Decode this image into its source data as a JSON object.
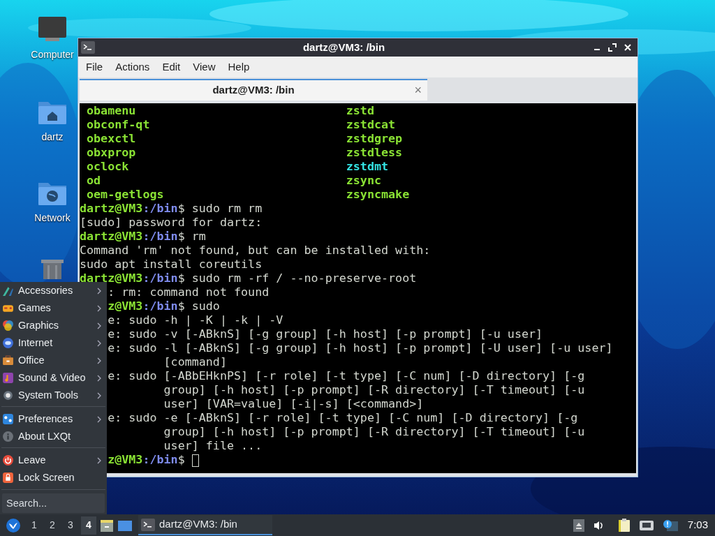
{
  "desktop_icons": [
    {
      "kind": "computer",
      "label": "Computer"
    },
    {
      "kind": "home",
      "label": "dartz"
    },
    {
      "kind": "network",
      "label": "Network"
    },
    {
      "kind": "trash"
    }
  ],
  "window": {
    "title": "dartz@VM3: /bin",
    "menu": [
      "File",
      "Actions",
      "Edit",
      "View",
      "Help"
    ],
    "tabs": [
      {
        "label": "dartz@VM3: /bin",
        "selected": true,
        "close": "×"
      }
    ]
  },
  "terminal": {
    "lines": [
      {
        "kind": "listing",
        "entries": [
          {
            "text": "obamenu",
            "color": "#8ae234"
          },
          {
            "text": "zstd",
            "color": "#8ae234"
          }
        ]
      },
      {
        "kind": "listing",
        "entries": [
          {
            "text": "obconf-qt",
            "color": "#8ae234"
          },
          {
            "text": "zstdcat",
            "color": "#8ae234"
          }
        ]
      },
      {
        "kind": "listing",
        "entries": [
          {
            "text": "obexctl",
            "color": "#8ae234"
          },
          {
            "text": "zstdgrep",
            "color": "#8ae234"
          }
        ]
      },
      {
        "kind": "listing",
        "entries": [
          {
            "text": "obxprop",
            "color": "#8ae234"
          },
          {
            "text": "zstdless",
            "color": "#8ae234"
          }
        ]
      },
      {
        "kind": "listing",
        "entries": [
          {
            "text": "oclock",
            "color": "#8ae234"
          },
          {
            "text": "zstdmt",
            "color": "#34e2e2"
          }
        ]
      },
      {
        "kind": "listing",
        "entries": [
          {
            "text": "od",
            "color": "#8ae234"
          },
          {
            "text": "zsync",
            "color": "#8ae234"
          }
        ]
      },
      {
        "kind": "listing",
        "entries": [
          {
            "text": "oem-getlogs",
            "color": "#8ae234"
          },
          {
            "text": "zsyncmake",
            "color": "#8ae234"
          }
        ]
      },
      {
        "kind": "prompt",
        "host": "dartz@VM3",
        "path": ":/bin",
        "command": "$ sudo rm rm",
        "covered": false
      },
      {
        "kind": "output",
        "text": "[sudo] password for dartz:",
        "covered": false
      },
      {
        "kind": "prompt",
        "host": "dartz@VM3",
        "path": ":/bin",
        "command": "$ rm",
        "covered": false
      },
      {
        "kind": "output",
        "text": "Command 'rm' not found, but can be installed with:",
        "covered": false
      },
      {
        "kind": "output",
        "text": "sudo apt install coreutils",
        "covered": false
      },
      {
        "kind": "prompt",
        "host": "dartz@VM3",
        "path": ":/bin",
        "command": "$ sudo rm -rf / --no-preserve-root",
        "covered": false
      },
      {
        "kind": "output",
        "text": ": rm: command not found",
        "covered": true
      },
      {
        "kind": "prompt",
        "host": "z@VM3",
        "path": ":/bin",
        "command": "$ sudo",
        "covered": true
      },
      {
        "kind": "output",
        "text": "e: sudo -h | -K | -k | -V",
        "covered": true
      },
      {
        "kind": "output",
        "text": "e: sudo -v [-ABknS] [-g group] [-h host] [-p prompt] [-u user]",
        "covered": true
      },
      {
        "kind": "output",
        "text": "e: sudo -l [-ABknS] [-g group] [-h host] [-p prompt] [-U user] [-u user]",
        "covered": true
      },
      {
        "kind": "continuation",
        "text": "[command]"
      },
      {
        "kind": "output",
        "text": "e: sudo [-ABbEHknPS] [-r role] [-t type] [-C num] [-D directory] [-g",
        "covered": true
      },
      {
        "kind": "continuation",
        "text": "group] [-h host] [-p prompt] [-R directory] [-T timeout] [-u"
      },
      {
        "kind": "continuation",
        "text": "user] [VAR=value] [-i|-s] [<command>]"
      },
      {
        "kind": "output",
        "text": "e: sudo -e [-ABknS] [-r role] [-t type] [-C num] [-D directory] [-g",
        "covered": true
      },
      {
        "kind": "continuation",
        "text": "group] [-h host] [-p prompt] [-R directory] [-T timeout] [-u"
      },
      {
        "kind": "continuation",
        "text": "user] file ..."
      },
      {
        "kind": "prompt",
        "host": "z@VM3",
        "path": ":/bin",
        "command": "$",
        "covered": true,
        "cursor": true
      }
    ]
  },
  "app_menu": {
    "groups": [
      [
        {
          "label": "Accessories",
          "submenu": true
        },
        {
          "label": "Games",
          "submenu": true
        },
        {
          "label": "Graphics",
          "submenu": true
        },
        {
          "label": "Internet",
          "submenu": true
        },
        {
          "label": "Office",
          "submenu": true
        },
        {
          "label": "Sound & Video",
          "submenu": true
        },
        {
          "label": "System Tools",
          "submenu": true
        }
      ],
      [
        {
          "label": "Preferences",
          "submenu": true
        },
        {
          "label": "About LXQt",
          "submenu": false
        }
      ],
      [
        {
          "label": "Leave",
          "submenu": true
        },
        {
          "label": "Lock Screen",
          "submenu": false
        }
      ]
    ],
    "search": {
      "placeholder": "Search..."
    }
  },
  "taskbar": {
    "desktops": [
      {
        "label": "1",
        "selected": false
      },
      {
        "label": "2",
        "selected": false
      },
      {
        "label": "3",
        "selected": false
      },
      {
        "label": "4",
        "selected": true
      }
    ],
    "tasks": [
      {
        "label": "dartz@VM3: /bin",
        "selected": true
      }
    ],
    "clock": "7:03"
  }
}
